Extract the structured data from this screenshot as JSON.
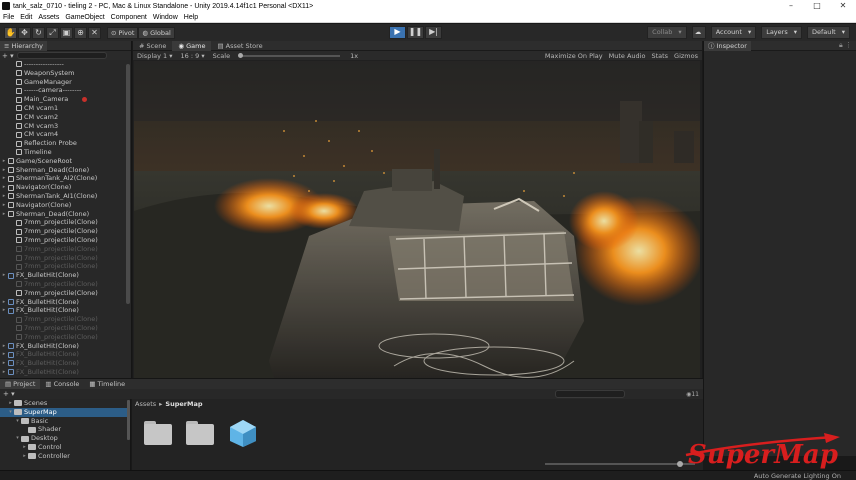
{
  "window": {
    "title": "tank_salz_0710 - tieling 2 - PC, Mac & Linux Standalone - Unity 2019.4.14f1c1 Personal <DX11>",
    "minimize": "–",
    "maximize": "□",
    "close": "✕"
  },
  "menu": [
    "File",
    "Edit",
    "Assets",
    "GameObject",
    "Component",
    "Window",
    "Help"
  ],
  "toolbar": {
    "pivot_label": "Pivot",
    "global_label": "Global",
    "collab_label": "Collab",
    "account_label": "Account",
    "layers_label": "Layers",
    "layout_label": "Default"
  },
  "hierarchy": {
    "tab_label": "Hierarchy",
    "items": [
      {
        "label": "-----------------",
        "dim": false,
        "expandable": false
      },
      {
        "label": "WeaponSystem",
        "dim": false,
        "expandable": false
      },
      {
        "label": "GameManager",
        "dim": false,
        "expandable": false
      },
      {
        "label": "------camera--------",
        "dim": false,
        "expandable": false
      },
      {
        "label": "Main_Camera",
        "dim": false,
        "expandable": false,
        "marker": true
      },
      {
        "label": "CM vcam1",
        "dim": false,
        "expandable": false
      },
      {
        "label": "CM vcam2",
        "dim": false,
        "expandable": false
      },
      {
        "label": "CM vcam3",
        "dim": false,
        "expandable": false
      },
      {
        "label": "CM vcam4",
        "dim": false,
        "expandable": false
      },
      {
        "label": "Reflection Probe",
        "dim": false,
        "expandable": false
      },
      {
        "label": "Timeline",
        "dim": false,
        "expandable": false
      },
      {
        "label": "Game/SceneRoot",
        "dim": false,
        "expandable": true
      },
      {
        "label": "Sherman_Dead(Clone)",
        "dim": false,
        "expandable": true
      },
      {
        "label": "ShermanTank_AI2(Clone)",
        "dim": false,
        "expandable": true
      },
      {
        "label": "Navigator(Clone)",
        "dim": false,
        "expandable": true
      },
      {
        "label": "ShermanTank_AI1(Clone)",
        "dim": false,
        "expandable": true
      },
      {
        "label": "Navigator(Clone)",
        "dim": false,
        "expandable": true
      },
      {
        "label": "Sherman_Dead(Clone)",
        "dim": false,
        "expandable": true
      },
      {
        "label": "7mm_projectile(Clone)",
        "dim": false,
        "expandable": false
      },
      {
        "label": "7mm_projectile(Clone)",
        "dim": false,
        "expandable": false
      },
      {
        "label": "7mm_projectile(Clone)",
        "dim": false,
        "expandable": false
      },
      {
        "label": "7mm_projectile(Clone)",
        "dim": true,
        "expandable": false
      },
      {
        "label": "7mm_projectile(Clone)",
        "dim": true,
        "expandable": false
      },
      {
        "label": "7mm_projectile(Clone)",
        "dim": true,
        "expandable": false
      },
      {
        "label": "FX_BulletHit(Clone)",
        "dim": false,
        "expandable": true,
        "fx": true
      },
      {
        "label": "7mm_projectile(Clone)",
        "dim": true,
        "expandable": false
      },
      {
        "label": "7mm_projectile(Clone)",
        "dim": false,
        "expandable": false
      },
      {
        "label": "FX_BulletHit(Clone)",
        "dim": false,
        "expandable": true,
        "fx": true
      },
      {
        "label": "FX_BulletHit(Clone)",
        "dim": false,
        "expandable": true,
        "fx": true
      },
      {
        "label": "7mm_projectile(Clone)",
        "dim": true,
        "expandable": false
      },
      {
        "label": "7mm_projectile(Clone)",
        "dim": true,
        "expandable": false
      },
      {
        "label": "7mm_projectile(Clone)",
        "dim": true,
        "expandable": false
      },
      {
        "label": "FX_BulletHit(Clone)",
        "dim": false,
        "expandable": true,
        "fx": true
      },
      {
        "label": "FX_BulletHit(Clone)",
        "dim": true,
        "expandable": true,
        "fx": true
      },
      {
        "label": "FX_BulletHit(Clone)",
        "dim": true,
        "expandable": true,
        "fx": true
      },
      {
        "label": "FX_BulletHit(Clone)",
        "dim": true,
        "expandable": true,
        "fx": true
      },
      {
        "label": "FX_BulletHit(Clone)",
        "dim": true,
        "expandable": true,
        "fx": true
      }
    ]
  },
  "center": {
    "tabs": [
      "Scene",
      "Game",
      "Asset Store"
    ],
    "active_tab": "Game",
    "display_label": "Display 1",
    "aspect_label": "16 : 9",
    "scale_label": "Scale",
    "scale_value": "1x",
    "maximize_label": "Maximize On Play",
    "mute_label": "Mute Audio",
    "stats_label": "Stats",
    "gizmos_label": "Gizmos"
  },
  "inspector": {
    "tab_label": "Inspector"
  },
  "project": {
    "tabs": [
      "Project",
      "Console",
      "Timeline"
    ],
    "active_tab": "Project",
    "count": "11",
    "tree": [
      {
        "label": "Scenes",
        "indent": 1,
        "arrow": "▸",
        "selected": false
      },
      {
        "label": "SuperMap",
        "indent": 1,
        "arrow": "▾",
        "selected": true
      },
      {
        "label": "Basic",
        "indent": 2,
        "arrow": "▾",
        "selected": false
      },
      {
        "label": "Shader",
        "indent": 3,
        "arrow": "",
        "selected": false
      },
      {
        "label": "Desktop",
        "indent": 2,
        "arrow": "▾",
        "selected": false
      },
      {
        "label": "Control",
        "indent": 3,
        "arrow": "▸",
        "selected": false
      },
      {
        "label": "Controller",
        "indent": 3,
        "arrow": "▸",
        "selected": false
      }
    ],
    "breadcrumb": [
      "Assets",
      "SuperMap"
    ]
  },
  "status": {
    "right_text": "Auto Generate Lighting On"
  },
  "watermark": {
    "text": "SuperMap"
  }
}
